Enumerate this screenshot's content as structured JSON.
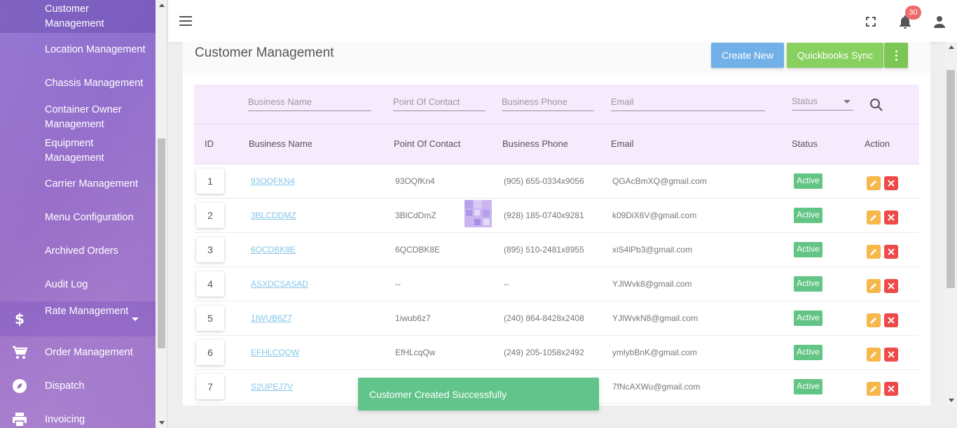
{
  "sidebar": {
    "items": [
      {
        "label": "Customer Management",
        "icon": ""
      },
      {
        "label": "Location Management",
        "icon": ""
      },
      {
        "label": "Chassis Management",
        "icon": ""
      },
      {
        "label": "Container Owner Management",
        "icon": ""
      },
      {
        "label": "Equipment Management",
        "icon": ""
      },
      {
        "label": "Carrier Management",
        "icon": ""
      },
      {
        "label": "Menu Configuration",
        "icon": ""
      },
      {
        "label": "Archived Orders",
        "icon": ""
      },
      {
        "label": "Audit Log",
        "icon": ""
      },
      {
        "label": "Rate Management",
        "icon": "dollar-icon"
      },
      {
        "label": "Order Management",
        "icon": "cart-icon"
      },
      {
        "label": "Dispatch",
        "icon": "compass-icon"
      },
      {
        "label": "Invoicing",
        "icon": "printer-icon"
      }
    ]
  },
  "topbar": {
    "notification_count": "30"
  },
  "page": {
    "title": "Customer Management",
    "create_label": "Create New",
    "quickbooks_label": "Quickbooks Sync"
  },
  "filters": {
    "business_name": "Business Name",
    "point_of_contact": "Point Of Contact",
    "business_phone": "Business Phone",
    "email": "Email",
    "status": "Status"
  },
  "table": {
    "headers": {
      "id": "ID",
      "business_name": "Business Name",
      "point_of_contact": "Point Of Contact",
      "business_phone": "Business Phone",
      "email": "Email",
      "status": "Status",
      "action": "Action"
    },
    "rows": [
      {
        "id": "1",
        "business_name": "93OQFKN4",
        "contact": "93OQfKn4",
        "phone": "(905) 655-0334x9056",
        "email": "QGAcBmXQ@gmail.com",
        "status": "Active"
      },
      {
        "id": "2",
        "business_name": "3BLCDDMZ",
        "contact": "3BlCdDmZ",
        "phone": "(928) 185-0740x9281",
        "email": "k09DiX6V@gmail.com",
        "status": "Active"
      },
      {
        "id": "3",
        "business_name": "6QCDBK8E",
        "contact": "6QCDBK8E",
        "phone": "(895) 510-2481x8955",
        "email": "xiS4lPb3@gmail.com",
        "status": "Active"
      },
      {
        "id": "4",
        "business_name": "ASXDCSASAD",
        "contact": "--",
        "phone": "--",
        "email": "YJlWvk8@gmail.com",
        "status": "Active"
      },
      {
        "id": "5",
        "business_name": "1IWUB6Z7",
        "contact": "1iwub6z7",
        "phone": "(240) 864-8428x2408",
        "email": "YJlWvkN8@gmail.com",
        "status": "Active"
      },
      {
        "id": "6",
        "business_name": "EFHLCQQW",
        "contact": "EfHLcqQw",
        "phone": "(249) 205-1058x2492",
        "email": "ymlybBnK@gmail.com",
        "status": "Active"
      },
      {
        "id": "7",
        "business_name": "S2UPEJ7V",
        "contact": "",
        "phone": "",
        "email": "7fNcAXWu@gmail.com",
        "status": "Active"
      }
    ]
  },
  "toast": {
    "message": "Customer Created Successfully"
  },
  "colors": {
    "sidebar": "#9a6fc8",
    "create_button": "#72b0e8",
    "quickbooks_button": "#88d05f",
    "status_active": "#63c585",
    "edit": "#f7b84b",
    "delete": "#ef4a4a",
    "toast": "#63c48b"
  }
}
